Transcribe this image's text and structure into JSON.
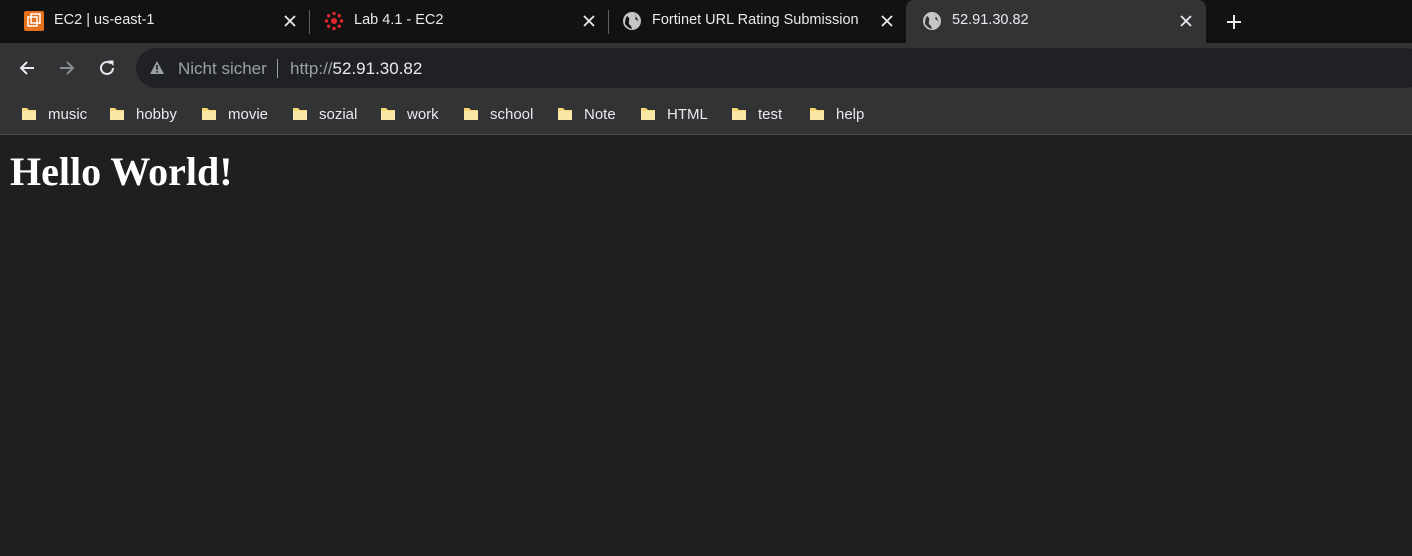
{
  "tabs": [
    {
      "title": "EC2 | us-east-1",
      "icon": "aws-ec2-icon",
      "active": false
    },
    {
      "title": "Lab 4.1 - EC2",
      "icon": "canvas-lms-icon",
      "active": false
    },
    {
      "title": "Fortinet URL Rating Submission",
      "icon": "globe-icon",
      "active": false
    },
    {
      "title": "52.91.30.82",
      "icon": "globe-icon",
      "active": true
    }
  ],
  "omnibox": {
    "security_label": "Nicht sicher",
    "url_scheme": "http://",
    "url_host": "52.91.30.82"
  },
  "bookmarks": [
    "music",
    "hobby",
    "movie",
    "sozial",
    "work",
    "school",
    "Note",
    "HTML",
    "test",
    "help"
  ],
  "page": {
    "heading": "Hello World!"
  },
  "colors": {
    "tabstrip": "#121212",
    "toolbar": "#323335",
    "omnibox": "#202124",
    "page_background": "#1e1f21",
    "folder": "#f8d775",
    "aws_orange": "#e7711b",
    "canvas_red": "#e0262b"
  }
}
